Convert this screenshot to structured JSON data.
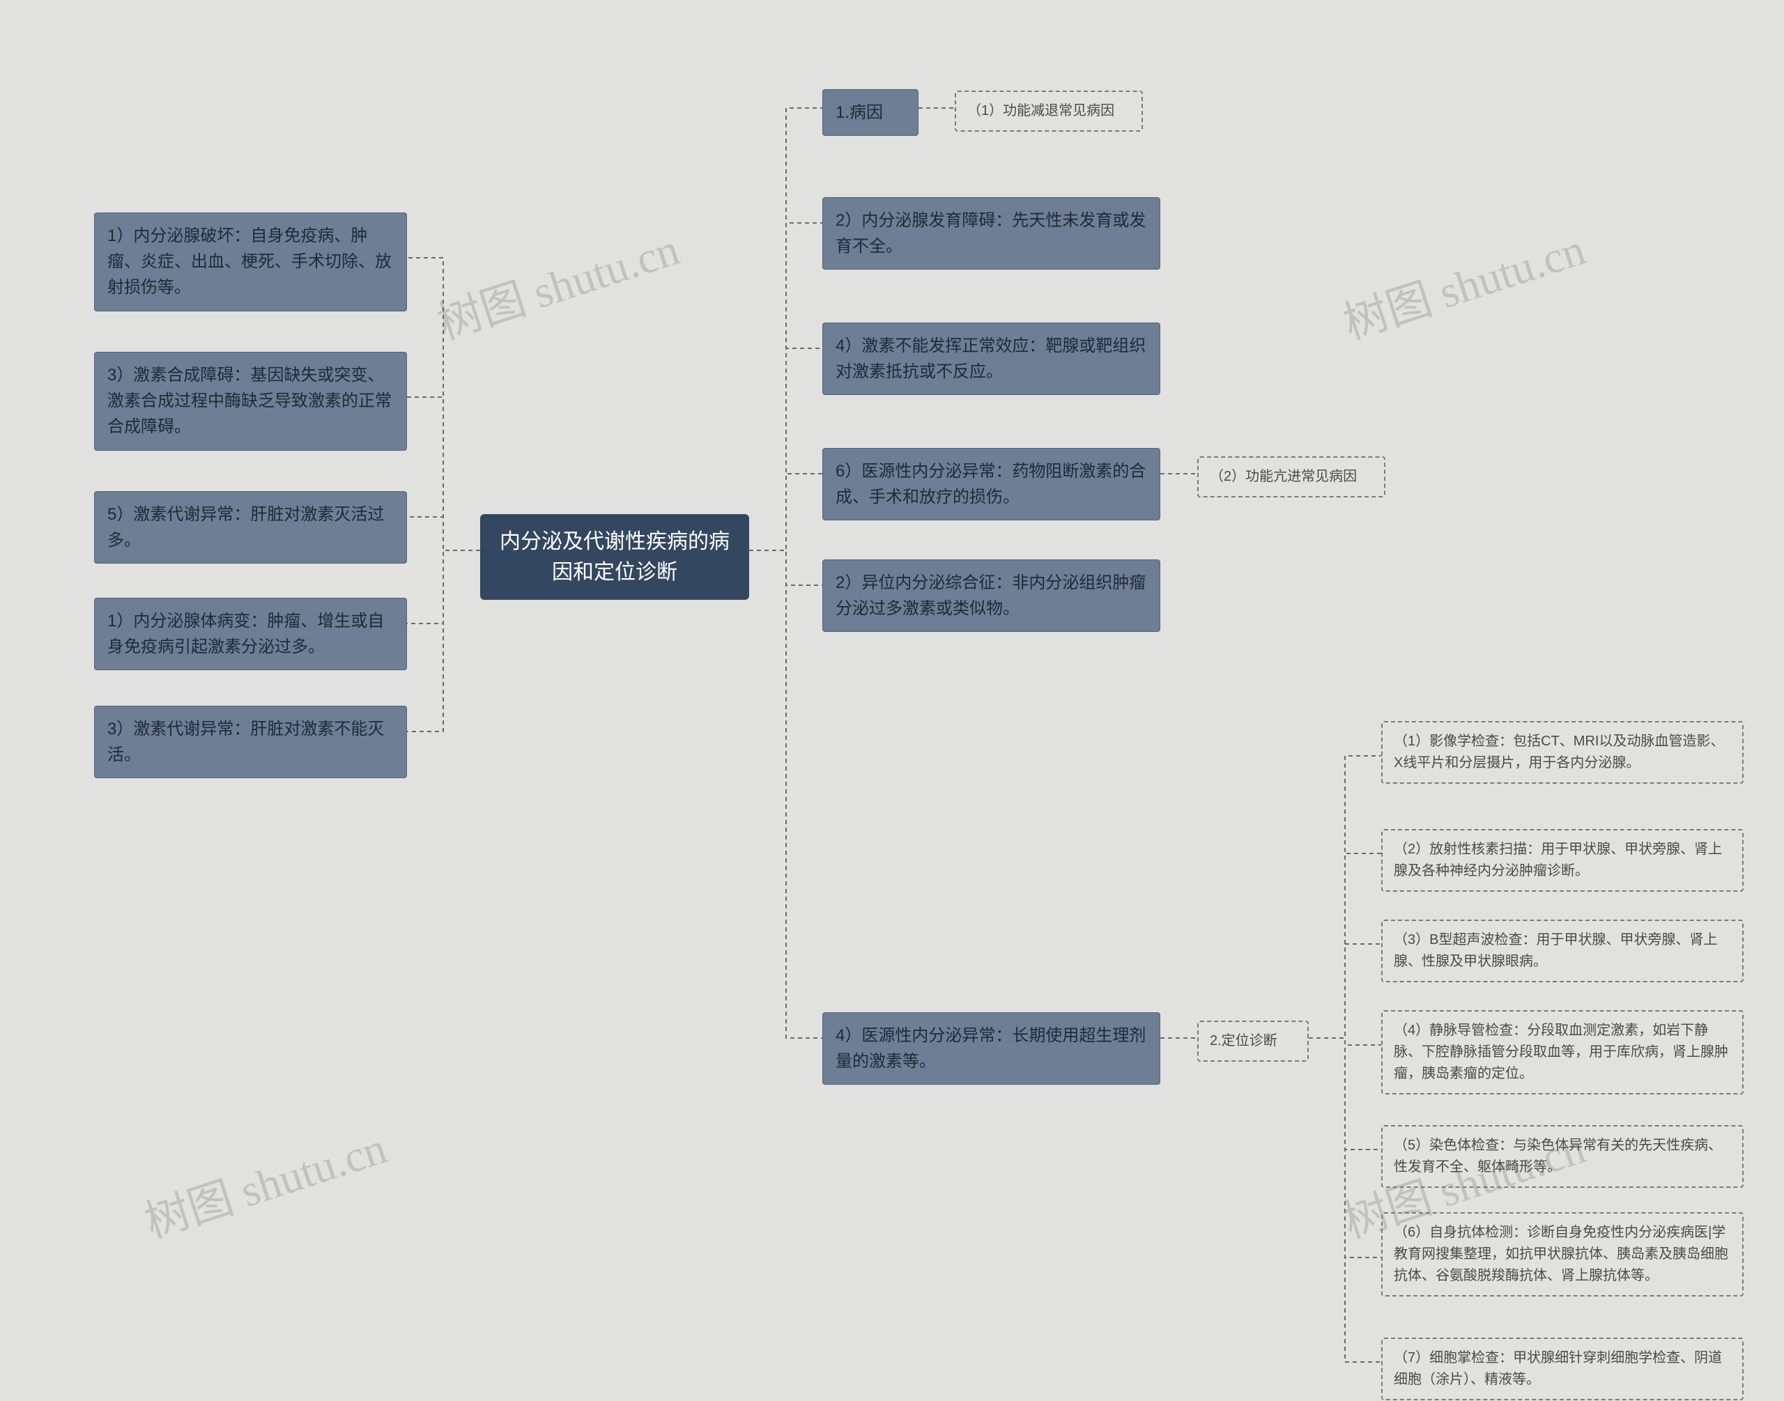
{
  "central": {
    "title": "内分泌及代谢性疾病的病\n因和定位诊断"
  },
  "left": {
    "n1": "1）内分泌腺破坏：自身免疫病、肿瘤、炎症、出血、梗死、手术切除、放射损伤等。",
    "n2": "3）激素合成障碍：基因缺失或突变、激素合成过程中酶缺乏导致激素的正常合成障碍。",
    "n3": "5）激素代谢异常：肝脏对激素灭活过多。",
    "n4": "1）内分泌腺体病变：肿瘤、增生或自身免疫病引起激素分泌过多。",
    "n5": "3）激素代谢异常：肝脏对激素不能灭活。"
  },
  "right": {
    "r1": "1.病因",
    "r1a": "（1）功能减退常见病因",
    "r2": "2）内分泌腺发育障碍：先天性未发育或发育不全。",
    "r3": "4）激素不能发挥正常效应：靶腺或靶组织对激素抵抗或不反应。",
    "r4": "6）医源性内分泌异常：药物阻断激素的合成、手术和放疗的损伤。",
    "r4a": "（2）功能亢进常见病因",
    "r5": "2）异位内分泌综合征：非内分泌组织肿瘤分泌过多激素或类似物。",
    "r6": "4）医源性内分泌异常：长期使用超生理剂量的激素等。",
    "r6a": "2.定位诊断"
  },
  "diag": {
    "d1": "（1）影像学检查：包括CT、MRI以及动脉血管造影、X线平片和分层摄片，用于各内分泌腺。",
    "d2": "（2）放射性核素扫描：用于甲状腺、甲状旁腺、肾上腺及各种神经内分泌肿瘤诊断。",
    "d3": "（3）B型超声波检查：用于甲状腺、甲状旁腺、肾上腺、性腺及甲状腺眼病。",
    "d4": "（4）静脉导管检查：分段取血测定激素，如岩下静脉、下腔静脉插管分段取血等，用于库欣病，肾上腺肿瘤，胰岛素瘤的定位。",
    "d5": "（5）染色体检查：与染色体异常有关的先天性疾病、性发育不全、躯体畸形等。",
    "d6": "（6）自身抗体检测：诊断自身免疫性内分泌疾病医|学教育网搜集整理，如抗甲状腺抗体、胰岛素及胰岛细胞抗体、谷氨酸脱羧酶抗体、肾上腺抗体等。",
    "d7": "（7）细胞掌检查：甲状腺细针穿刺细胞学检查、阴道细胞（涂片）、精液等。"
  },
  "watermarks": [
    "树图 shutu.cn",
    "树图 shutu.cn",
    "树图 shutu.cn",
    "树图 shutu.cn"
  ]
}
